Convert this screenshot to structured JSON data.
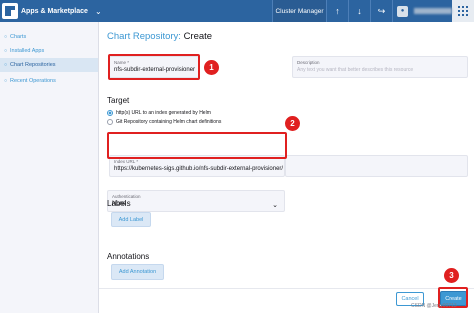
{
  "topbar": {
    "app_title": "Apps & Marketplace",
    "cluster_manager": "Cluster Manager",
    "icons": [
      "chevron-down-icon",
      "upload-icon",
      "download-icon",
      "branch-icon",
      "user-icon",
      "menu-grid-icon"
    ]
  },
  "sidebar": {
    "items": [
      {
        "label": "Charts",
        "active": false
      },
      {
        "label": "Installed Apps",
        "active": false
      },
      {
        "label": "Chart Repositories",
        "active": true
      },
      {
        "label": "Recent Operations",
        "active": false
      }
    ]
  },
  "page": {
    "title_crumb": "Chart Repository:",
    "title_action": "Create"
  },
  "form": {
    "name_label": "Name *",
    "name_value": "nfs-subdir-external-provisioner",
    "description_label": "Description",
    "description_placeholder": "Any text you want that better describes this resource",
    "target_title": "Target",
    "target_options": [
      {
        "label": "http(s) URL to an index generated by Helm",
        "checked": true
      },
      {
        "label": "Git Repository containing Helm chart definitions",
        "checked": false
      }
    ],
    "index_url_label": "Index URL *",
    "index_url_value": "https://kubernetes-sigs.github.io/nfs-subdir-external-provisioner/",
    "auth_label": "Authentication",
    "auth_value": "None",
    "labels_title": "Labels",
    "add_label": "Add Label",
    "annotations_title": "Annotations",
    "add_annotation": "Add Annotation"
  },
  "footer": {
    "cancel": "Cancel",
    "create": "Create"
  },
  "annotations_overlay": {
    "badges": [
      "1",
      "2",
      "3"
    ],
    "color": "#e02020"
  },
  "watermark": "CSDN @Jerry00713",
  "colors": {
    "topbar": "#2c64a0",
    "accent": "#3d98d3",
    "sidebar_bg": "#f4f5fa"
  }
}
